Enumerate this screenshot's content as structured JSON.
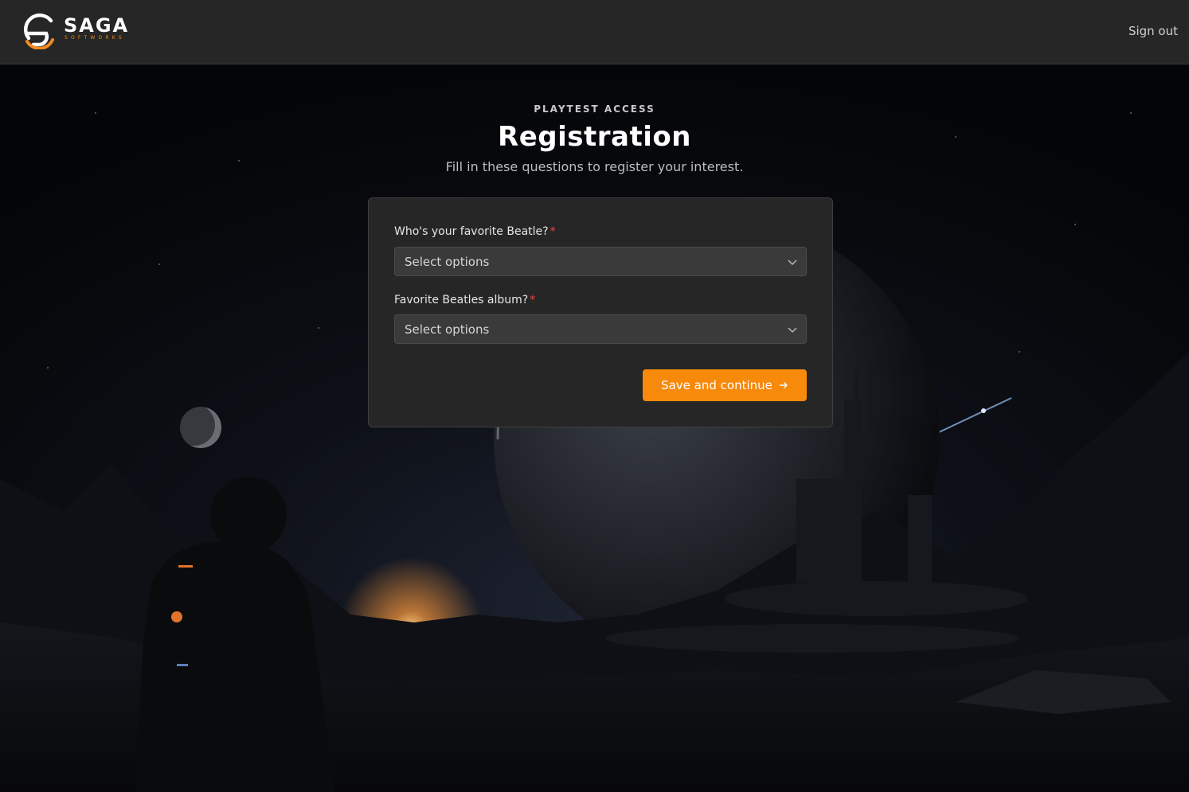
{
  "header": {
    "logo_word": "SAGA",
    "logo_sub": "SOFTWORKS",
    "signout_label": "Sign out"
  },
  "intro": {
    "eyebrow": "PLAYTEST ACCESS",
    "title": "Registration",
    "subtitle": "Fill in these questions to register your interest."
  },
  "form": {
    "fields": [
      {
        "label": "Who's your favorite Beatle?",
        "required_mark": "*",
        "placeholder": "Select options"
      },
      {
        "label": "Favorite Beatles album?",
        "required_mark": "*",
        "placeholder": "Select options"
      }
    ],
    "submit_label": "Save and continue",
    "submit_icon": "arrow-right-icon"
  },
  "colors": {
    "accent": "#f7890b",
    "header_bg": "#262626",
    "card_bg": "#262626",
    "required": "#ef4444"
  }
}
